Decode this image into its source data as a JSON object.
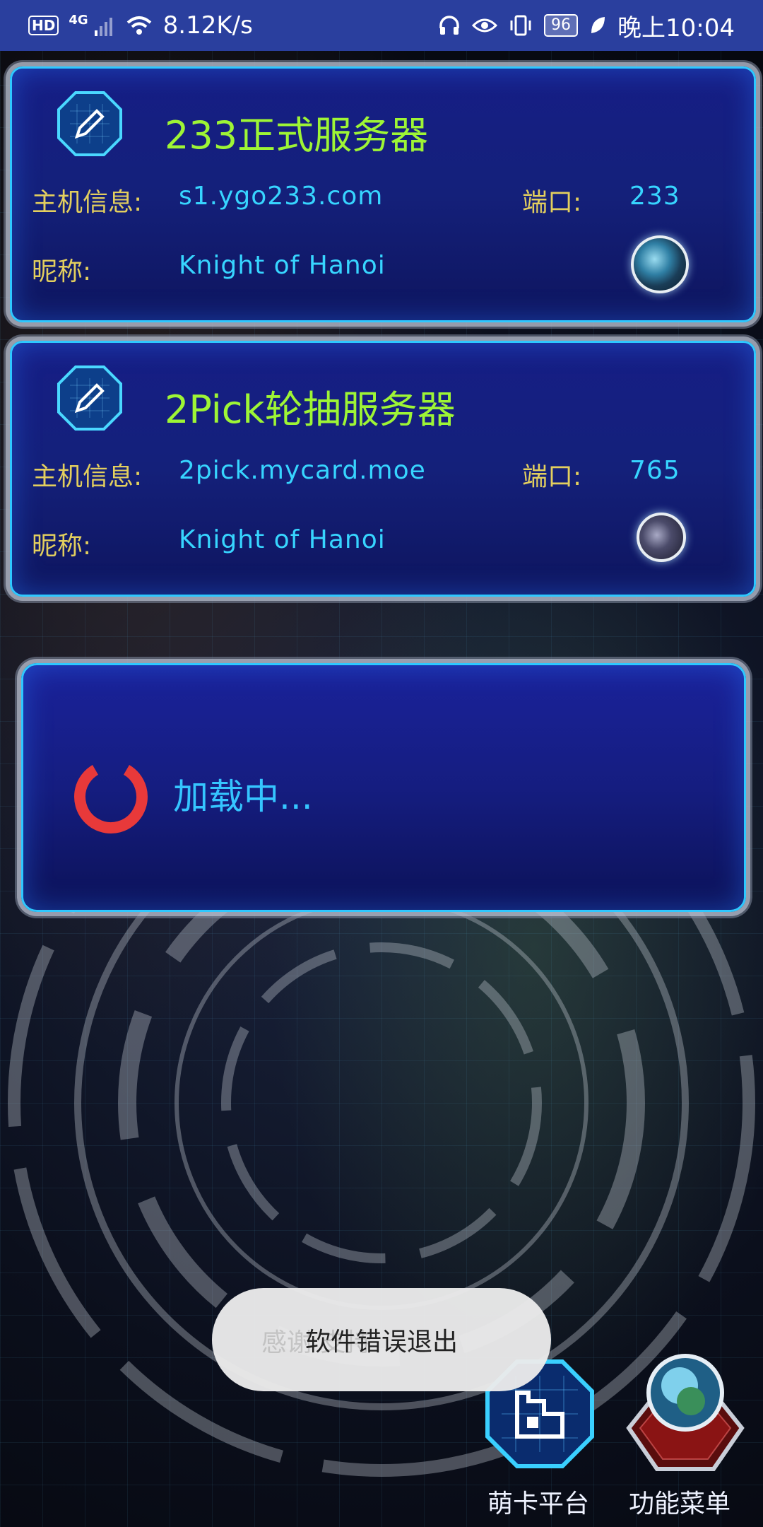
{
  "status_bar": {
    "hd": "HD",
    "network": "4G",
    "speed": "8.12K/s",
    "battery": "96",
    "time": "晚上10:04"
  },
  "servers": [
    {
      "title": "233正式服务器",
      "host_label": "主机信息:",
      "host": "s1.ygo233.com",
      "port_label": "端口:",
      "port": "233",
      "nick_label": "昵称:",
      "nickname": "Knight of Hanoi"
    },
    {
      "title": "2Pick轮抽服务器",
      "host_label": "主机信息:",
      "host": "2pick.mycard.moe",
      "port_label": "端口:",
      "port": "765",
      "nick_label": "昵称:",
      "nickname": "Knight of Hanoi"
    }
  ],
  "loading": {
    "text": "加载中..."
  },
  "toast": {
    "ghost_text": "感谢                  支持",
    "text": "软件错误退出"
  },
  "bottom_nav": {
    "mycard_label": "萌卡平台",
    "menu_label": "功能菜单"
  },
  "colors": {
    "statusbar": "#2a3f9e",
    "title_green": "#9ef535",
    "label_gold": "#e3cf5e",
    "value_cyan": "#37d5ff",
    "spinner_red": "#e8393a"
  }
}
